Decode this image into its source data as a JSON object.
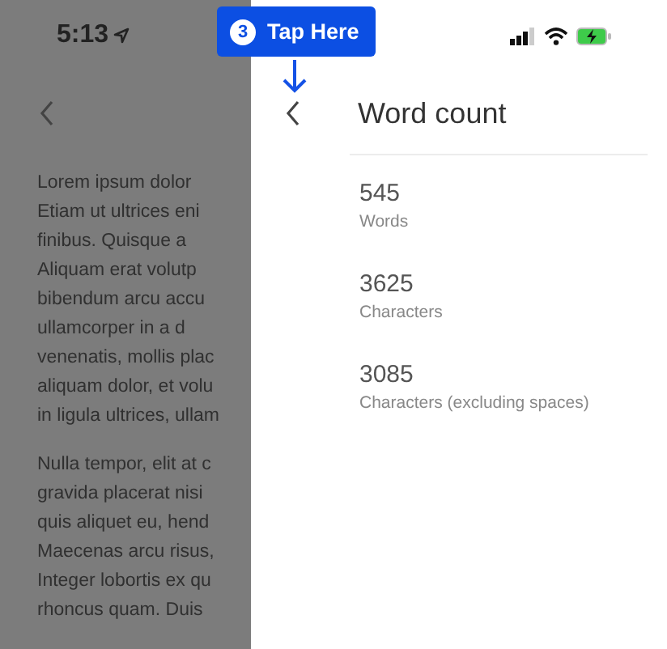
{
  "status_bar": {
    "time": "5:13"
  },
  "callout": {
    "step": "3",
    "label": "Tap Here"
  },
  "document": {
    "paragraphs": [
      [
        "Lorem ipsum dolor",
        "Etiam ut ultrices eni",
        "finibus. Quisque a",
        "Aliquam erat volutp",
        "bibendum arcu accu",
        "ullamcorper in a d",
        "venenatis, mollis plac",
        "aliquam dolor, et volu",
        "in ligula ultrices, ullam"
      ],
      [
        "Nulla tempor, elit at c",
        "gravida placerat nisi",
        "quis aliquet eu, hend",
        "Maecenas arcu risus,",
        "Integer lobortis ex qu",
        "rhoncus quam. Duis"
      ]
    ]
  },
  "panel": {
    "title": "Word count",
    "stats": [
      {
        "value": "545",
        "label": "Words"
      },
      {
        "value": "3625",
        "label": "Characters"
      },
      {
        "value": "3085",
        "label": "Characters (excluding spaces)"
      }
    ]
  }
}
